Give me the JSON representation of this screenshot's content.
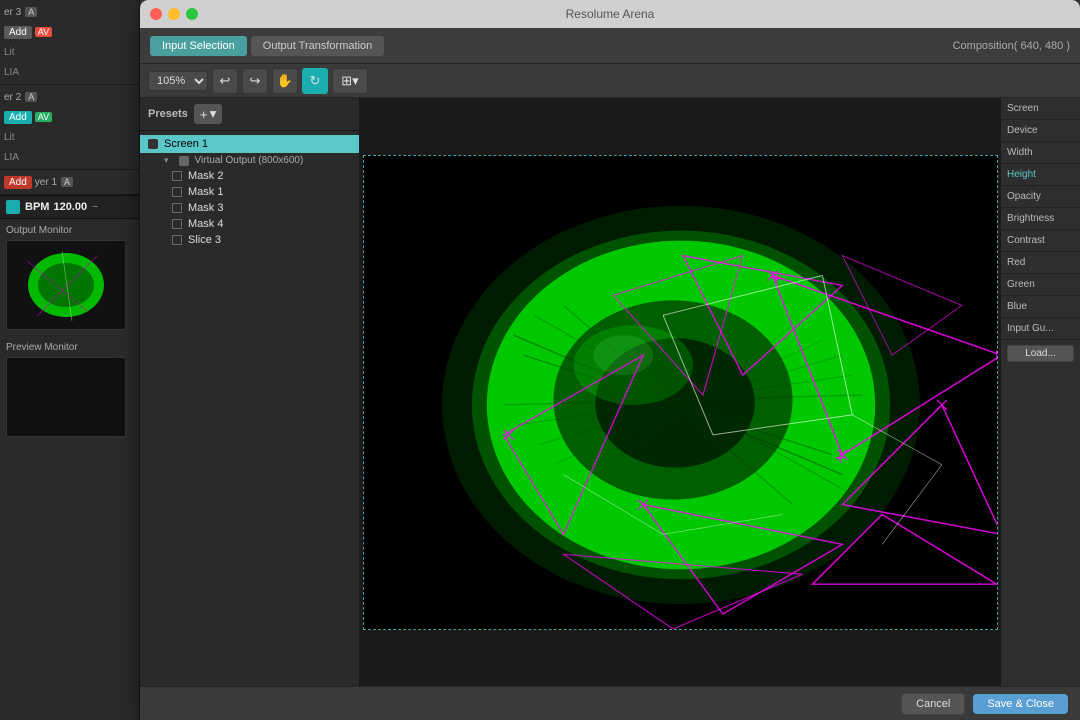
{
  "window": {
    "title": "Resolume Arena",
    "traffic_lights": [
      "close",
      "minimize",
      "maximize"
    ]
  },
  "tabs": {
    "input_selection": "Input Selection",
    "output_transformation": "Output Transformation"
  },
  "composition_info": "Composition( 640, 480 )",
  "toolbar": {
    "zoom": "105%",
    "undo": "↩",
    "redo": "↪"
  },
  "presets": {
    "header": "Presets",
    "add_button": "+",
    "items": [
      {
        "name": "Screen 1",
        "selected": true,
        "children": [
          {
            "name": "Virtual Output (800x600)",
            "masks": [
              "Mask 2",
              "Mask 1",
              "Mask 3",
              "Mask 4",
              "Slice 3"
            ]
          }
        ]
      }
    ]
  },
  "properties": {
    "items": [
      "Screen",
      "Device",
      "Width",
      "Height",
      "Opacity",
      "Brightness",
      "Contrast",
      "Red",
      "Green",
      "Blue",
      "Input Gu..."
    ],
    "load_button": "Load..."
  },
  "left_panel": {
    "layers": [
      {
        "label": "er 3",
        "add": "Add",
        "badge": "AV",
        "badge_a": "A",
        "sub": [
          "Lit",
          "LIA"
        ]
      },
      {
        "label": "er 2",
        "add": "Add",
        "badge_type": "teal",
        "sub": [
          "Lit",
          "LIA"
        ]
      },
      {
        "label": "yer 1",
        "add_type": "red"
      }
    ],
    "bpm": {
      "label": "BPM",
      "value": "120.00"
    },
    "output_monitor": "Output Monitor",
    "preview_monitor": "Preview Monitor"
  },
  "bottom": {
    "cancel": "Cancel",
    "save_close": "Save & Close"
  }
}
